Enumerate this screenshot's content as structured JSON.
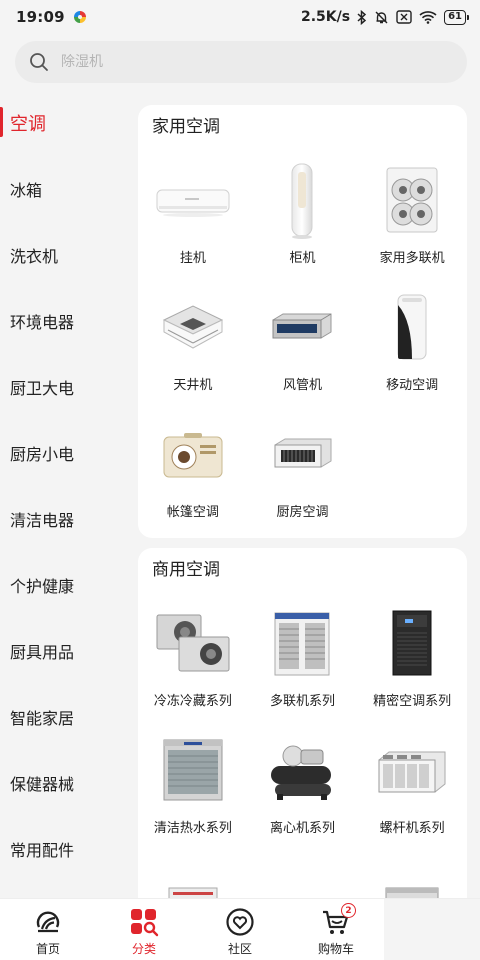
{
  "status_bar": {
    "time": "19:09",
    "network_speed": "2.5K/s",
    "battery": "61",
    "icons": [
      "app-notification-icon",
      "bluetooth-icon",
      "mute-icon",
      "sim-off-icon",
      "wifi-icon",
      "battery-icon"
    ]
  },
  "search": {
    "placeholder": "除湿机",
    "icon": "search-icon"
  },
  "sidebar": {
    "active_index": 0,
    "items": [
      {
        "label": "空调"
      },
      {
        "label": "冰箱"
      },
      {
        "label": "洗衣机"
      },
      {
        "label": "环境电器"
      },
      {
        "label": "厨卫大电"
      },
      {
        "label": "厨房小电"
      },
      {
        "label": "清洁电器"
      },
      {
        "label": "个护健康"
      },
      {
        "label": "厨具用品"
      },
      {
        "label": "智能家居"
      },
      {
        "label": "保健器械"
      },
      {
        "label": "常用配件"
      }
    ]
  },
  "sections": [
    {
      "title": "家用空调",
      "items": [
        {
          "label": "挂机",
          "icon": "wall-ac-unit"
        },
        {
          "label": "柜机",
          "icon": "floor-ac-cabinet"
        },
        {
          "label": "家用多联机",
          "icon": "multi-split-outdoor-unit"
        },
        {
          "label": "天井机",
          "icon": "ceiling-cassette-unit"
        },
        {
          "label": "风管机",
          "icon": "duct-unit"
        },
        {
          "label": "移动空调",
          "icon": "portable-ac"
        },
        {
          "label": "帐篷空调",
          "icon": "tent-ac"
        },
        {
          "label": "厨房空调",
          "icon": "kitchen-ac"
        }
      ]
    },
    {
      "title": "商用空调",
      "items": [
        {
          "label": "冷冻冷藏系列",
          "icon": "condensing-units"
        },
        {
          "label": "多联机系列",
          "icon": "vrf-outdoor-unit"
        },
        {
          "label": "精密空调系列",
          "icon": "precision-ac-cabinet"
        },
        {
          "label": "清洁热水系列",
          "icon": "heat-pump-water-heater"
        },
        {
          "label": "离心机系列",
          "icon": "centrifugal-chiller"
        },
        {
          "label": "螺杆机系列",
          "icon": "screw-chiller"
        }
      ]
    }
  ],
  "tabbar": {
    "active_index": 1,
    "items": [
      {
        "label": "首页",
        "icon": "home-logo-icon"
      },
      {
        "label": "分类",
        "icon": "category-icon"
      },
      {
        "label": "社区",
        "icon": "community-heart-icon"
      },
      {
        "label": "购物车",
        "icon": "cart-icon",
        "badge": "2"
      }
    ]
  },
  "colors": {
    "accent": "#e0252c",
    "background": "#f4f4f4",
    "card": "#ffffff"
  }
}
